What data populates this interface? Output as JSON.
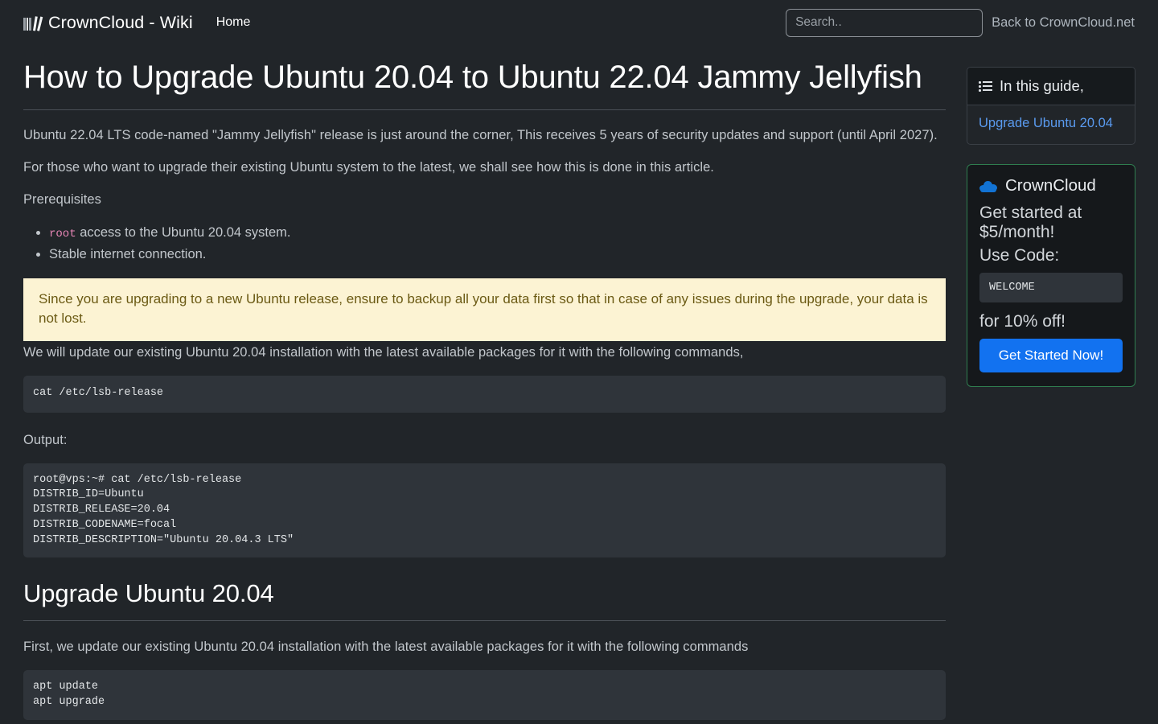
{
  "navbar": {
    "logo_icon": "books-icon",
    "brand": "CrownCloud - Wiki",
    "home_label": "Home",
    "search_placeholder": "Search..",
    "search_value": "",
    "back_link": "Back to CrownCloud.net"
  },
  "article": {
    "title": "How to Upgrade Ubuntu 20.04 to Ubuntu 22.04 Jammy Jellyfish",
    "intro_1": "Ubuntu 22.04 LTS code-named \"Jammy Jellyfish\" release is just around the corner, This receives 5 years of security updates and support (until April 2027).",
    "intro_2": "For those who want to upgrade their existing Ubuntu system to the latest, we shall see how this is done in this article.",
    "prereq_heading": "Prerequisites",
    "prereq_items": [
      {
        "code": "root",
        "text": " access to the Ubuntu 20.04 system."
      },
      {
        "code": "",
        "text": "Stable internet connection."
      }
    ],
    "callout": "Since you are upgrading to a new Ubuntu release, ensure to backup all your data first so that in case of any issues during the upgrade, your data is not lost.",
    "update_note": "We will update our existing Ubuntu 20.04 installation with the latest available packages for it with the following commands,",
    "code_1": "cat /etc/lsb-release",
    "output_label": "Output:",
    "code_output": "root@vps:~# cat /etc/lsb-release\nDISTRIB_ID=Ubuntu\nDISTRIB_RELEASE=20.04\nDISTRIB_CODENAME=focal\nDISTRIB_DESCRIPTION=\"Ubuntu 20.04.3 LTS\"",
    "section_title": "Upgrade Ubuntu 20.04",
    "section_note": "First, we update our existing Ubuntu 20.04 installation with the latest available packages for it with the following commands",
    "code_2": "apt update\napt upgrade"
  },
  "sidebar": {
    "toc": {
      "icon": "list-icon",
      "header": "In this guide,",
      "links": [
        "Upgrade Ubuntu 20.04"
      ]
    },
    "promo": {
      "icon": "cloud-icon",
      "brand": "CrownCloud",
      "line_1": "Get started at $5/month!",
      "line_2": "Use Code:",
      "code": "WELCOME",
      "line_3": "for 10% off!",
      "button": "Get Started Now!",
      "border_color": "#2f7d4f",
      "button_color": "#1272f0",
      "brand_icon_color": "#1273d4"
    }
  },
  "theme": {
    "page_bg": "#212529",
    "code_bg": "#2f343a",
    "callout_bg": "#fcf3d3",
    "callout_text": "#6b5a14",
    "link_blue": "#5a9bf0",
    "inline_code": "#e685b5"
  }
}
